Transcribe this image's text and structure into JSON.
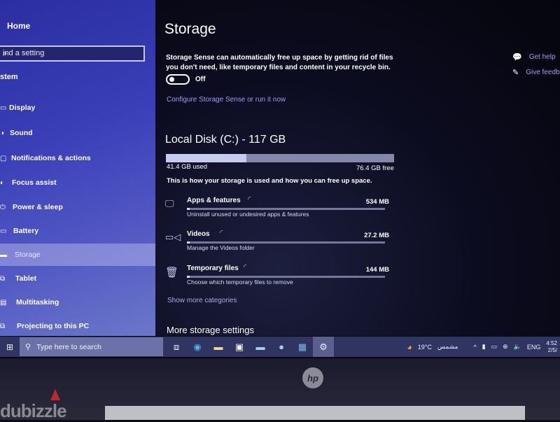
{
  "sidebar": {
    "home": "Home",
    "search_placeholder": "ind a setting",
    "section": "stem",
    "items": [
      {
        "label": "Display",
        "icon": "display-icon"
      },
      {
        "label": "Sound",
        "icon": "sound-icon"
      },
      {
        "label": "Notifications & actions",
        "icon": "notifications-icon"
      },
      {
        "label": "Focus assist",
        "icon": "focus-assist-icon"
      },
      {
        "label": "Power & sleep",
        "icon": "power-icon"
      },
      {
        "label": "Battery",
        "icon": "battery-icon"
      },
      {
        "label": "Storage",
        "icon": "storage-icon",
        "active": true
      },
      {
        "label": "Tablet",
        "icon": "tablet-icon"
      },
      {
        "label": "Multitasking",
        "icon": "multitasking-icon"
      },
      {
        "label": "Projecting to this PC",
        "icon": "projecting-icon"
      }
    ]
  },
  "main": {
    "title": "Storage",
    "description": "Storage Sense can automatically free up space by getting rid of files you don't need, like temporary files and content in your recycle bin.",
    "toggle_state": "Off",
    "configure_link": "Configure Storage Sense or run it now",
    "disk": {
      "title": "Local Disk (C:) - 117 GB",
      "used": "41.4 GB used",
      "free": "76.4 GB free",
      "used_fraction": 0.354
    },
    "howto": "This is how your storage is used and how you can free up space.",
    "categories": [
      {
        "name": "Apps & features",
        "size": "534 MB",
        "sub": "Uninstall unused or undesired apps & features",
        "fraction": 0.01
      },
      {
        "name": "Videos",
        "size": "27.2 MB",
        "sub": "Manage the Videos folder",
        "fraction": 0.005
      },
      {
        "name": "Temporary files",
        "size": "144 MB",
        "sub": "Choose which temporary files to remove",
        "fraction": 0.005
      }
    ],
    "show_more": "Show more categories",
    "more_settings": "More storage settings",
    "help": {
      "get_help": "Get help",
      "feedback": "Give feedb"
    }
  },
  "taskbar": {
    "search_placeholder": "Type here to search",
    "weather_temp": "19°C",
    "weather_desc": "مشمس",
    "language": "ENG",
    "time": "4:52",
    "date": "2/5/"
  },
  "bezel": {
    "brand": "hp",
    "watermark": "dubizzle"
  }
}
